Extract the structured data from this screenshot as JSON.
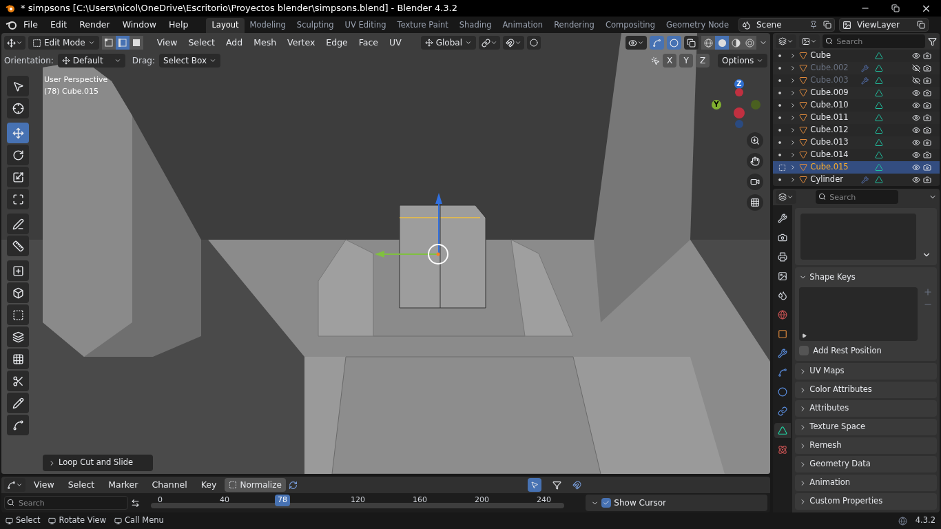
{
  "title_bar": {
    "title": "* simpsons [C:\\Users\\nicol\\OneDrive\\Escritorio\\Proyectos blender\\simpsons.blend] - Blender 4.3.2"
  },
  "menu": [
    "File",
    "Edit",
    "Render",
    "Window",
    "Help"
  ],
  "workspaces": [
    {
      "label": "Layout",
      "selected": true
    },
    {
      "label": "Modeling",
      "selected": false
    },
    {
      "label": "Sculpting",
      "selected": false
    },
    {
      "label": "UV Editing",
      "selected": false
    },
    {
      "label": "Texture Paint",
      "selected": false
    },
    {
      "label": "Shading",
      "selected": false
    },
    {
      "label": "Animation",
      "selected": false
    },
    {
      "label": "Rendering",
      "selected": false
    },
    {
      "label": "Compositing",
      "selected": false
    },
    {
      "label": "Geometry Node",
      "selected": false
    }
  ],
  "scene": {
    "value": "Scene"
  },
  "view_layer": {
    "value": "ViewLayer"
  },
  "viewport": {
    "mode": "Edit Mode",
    "select_modes": [
      {
        "kind": "vertex",
        "selected": false
      },
      {
        "kind": "edge",
        "selected": true
      },
      {
        "kind": "face",
        "selected": false
      }
    ],
    "menus": [
      "View",
      "Select",
      "Add",
      "Mesh",
      "Vertex",
      "Edge",
      "Face",
      "UV"
    ],
    "transform_orientation": "Global",
    "shading": [
      {
        "kind": "wireframe",
        "selected": false
      },
      {
        "kind": "solid",
        "selected": true
      },
      {
        "kind": "material",
        "selected": false
      },
      {
        "kind": "rendered",
        "selected": false
      }
    ],
    "tool_options": {
      "orientation_label": "Orientation:",
      "orientation": "Default",
      "drag_label": "Drag:",
      "drag": "Select Box"
    },
    "axes": [
      "X",
      "Y",
      "Z"
    ],
    "options": "Options",
    "info": [
      "User Perspective",
      "(78) Cube.015"
    ],
    "gizmo": {
      "z": "Z",
      "y": "Y"
    },
    "tools": [
      {
        "kind": "select",
        "selected": false
      },
      {
        "kind": "cursor",
        "selected": false
      },
      {
        "kind": "move",
        "selected": true
      },
      {
        "kind": "rotate",
        "selected": false
      },
      {
        "kind": "scale",
        "selected": false
      },
      {
        "kind": "transform",
        "selected": false
      },
      {
        "kind": "annotate",
        "selected": false
      },
      {
        "kind": "measure",
        "selected": false
      },
      {
        "kind": "add",
        "selected": false
      },
      {
        "kind": "extrude",
        "selected": false
      },
      {
        "kind": "inset",
        "selected": false
      },
      {
        "kind": "bevel",
        "selected": false
      },
      {
        "kind": "loopcut",
        "selected": false
      },
      {
        "kind": "knife",
        "selected": false
      },
      {
        "kind": "polybuild",
        "selected": false
      },
      {
        "kind": "spin",
        "selected": false
      }
    ],
    "last_operator": "Loop Cut and Slide"
  },
  "outliner": {
    "search": {
      "placeholder": "Search"
    },
    "items": [
      {
        "name": "Cube",
        "dimmed": false,
        "modifier": false,
        "visible": true,
        "selected": false
      },
      {
        "name": "Cube.002",
        "dimmed": true,
        "modifier": true,
        "visible": false,
        "selected": false
      },
      {
        "name": "Cube.003",
        "dimmed": true,
        "modifier": true,
        "visible": false,
        "selected": false
      },
      {
        "name": "Cube.009",
        "dimmed": false,
        "modifier": false,
        "visible": true,
        "selected": false
      },
      {
        "name": "Cube.010",
        "dimmed": false,
        "modifier": false,
        "visible": true,
        "selected": false
      },
      {
        "name": "Cube.011",
        "dimmed": false,
        "modifier": false,
        "visible": true,
        "selected": false
      },
      {
        "name": "Cube.012",
        "dimmed": false,
        "modifier": false,
        "visible": true,
        "selected": false
      },
      {
        "name": "Cube.013",
        "dimmed": false,
        "modifier": false,
        "visible": true,
        "selected": false
      },
      {
        "name": "Cube.014",
        "dimmed": false,
        "modifier": false,
        "visible": true,
        "selected": false
      },
      {
        "name": "Cube.015",
        "dimmed": false,
        "modifier": false,
        "visible": true,
        "selected": true
      },
      {
        "name": "Cylinder",
        "dimmed": false,
        "modifier": true,
        "visible": true,
        "selected": false
      }
    ]
  },
  "properties": {
    "search": {
      "placeholder": "Search"
    },
    "tabs": [
      {
        "kind": "tool",
        "selected": false
      },
      {
        "kind": "render",
        "selected": false
      },
      {
        "kind": "output",
        "selected": false
      },
      {
        "kind": "view_layer",
        "selected": false
      },
      {
        "kind": "scene",
        "selected": false
      },
      {
        "kind": "world",
        "selected": false
      },
      {
        "kind": "object",
        "selected": false
      },
      {
        "kind": "modifiers",
        "selected": false
      },
      {
        "kind": "particles",
        "selected": false
      },
      {
        "kind": "physics",
        "selected": false
      },
      {
        "kind": "constraints",
        "selected": false
      },
      {
        "kind": "data",
        "selected": true
      },
      {
        "kind": "material",
        "selected": false
      }
    ],
    "shape_keys": {
      "title": "Shape Keys",
      "expanded": true,
      "add_rest_position": {
        "label": "Add Rest Position",
        "checked": false
      }
    },
    "panels": [
      {
        "title": "UV Maps",
        "expanded": false
      },
      {
        "title": "Color Attributes",
        "expanded": false
      },
      {
        "title": "Attributes",
        "expanded": false
      },
      {
        "title": "Texture Space",
        "expanded": false
      },
      {
        "title": "Remesh",
        "expanded": false
      },
      {
        "title": "Geometry Data",
        "expanded": false
      },
      {
        "title": "Animation",
        "expanded": false
      },
      {
        "title": "Custom Properties",
        "expanded": false
      }
    ]
  },
  "timeline": {
    "menus": [
      "View",
      "Select",
      "Marker",
      "Channel",
      "Key"
    ],
    "normalize": {
      "label": "Normalize",
      "on": false
    },
    "search": {
      "placeholder": "Search"
    },
    "ticks": [
      "0",
      "40",
      "120",
      "160",
      "200",
      "240"
    ],
    "current_frame": "78",
    "show_cursor": {
      "label": "Show Cursor",
      "checked": true
    }
  },
  "status_bar": {
    "hints": [
      "Select",
      "Rotate View",
      "Call Menu"
    ],
    "version": "4.3.2"
  }
}
